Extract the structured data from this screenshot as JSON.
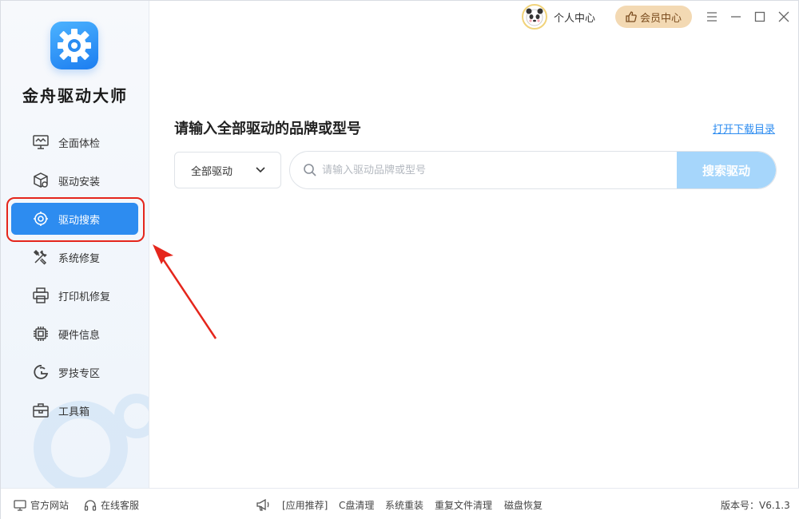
{
  "app": {
    "title": "金舟驱动大师",
    "accent": "#2d8cf0"
  },
  "header": {
    "user_center": "个人中心",
    "vip_button": "会员中心"
  },
  "sidebar": {
    "items": [
      {
        "label": "全面体检",
        "icon": "monitor-icon"
      },
      {
        "label": "驱动安装",
        "icon": "package-icon"
      },
      {
        "label": "驱动搜索",
        "icon": "gear-search-icon",
        "active": true
      },
      {
        "label": "系统修复",
        "icon": "tools-icon"
      },
      {
        "label": "打印机修复",
        "icon": "printer-icon"
      },
      {
        "label": "硬件信息",
        "icon": "chip-icon"
      },
      {
        "label": "罗技专区",
        "icon": "logitech-icon"
      },
      {
        "label": "工具箱",
        "icon": "toolbox-icon"
      }
    ]
  },
  "main": {
    "heading": "请输入全部驱动的品牌或型号",
    "open_dir_link": "打开下载目录",
    "dropdown_value": "全部驱动",
    "search_placeholder": "请输入驱动品牌或型号",
    "search_button": "搜索驱动"
  },
  "footer": {
    "website": "官方网站",
    "support": "在线客服",
    "recommend_label": "[应用推荐]",
    "links": [
      "C盘清理",
      "系统重装",
      "重复文件清理",
      "磁盘恢复"
    ],
    "version": "版本号：V6.1.3"
  }
}
